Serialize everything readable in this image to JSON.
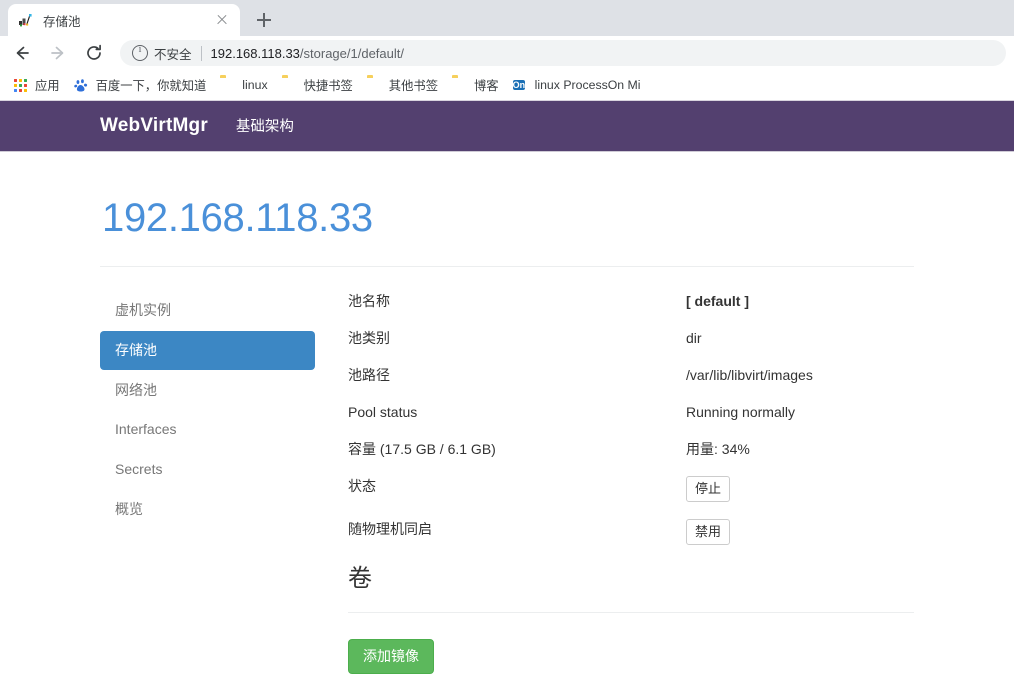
{
  "browser": {
    "tab": {
      "title": "存储池",
      "favicon": "webvirtmgr-favicon",
      "close_label": "×"
    },
    "newtab_label": "+",
    "toolbar": {
      "back": "back-arrow",
      "forward": "forward-arrow",
      "reload": "reload",
      "security_label": "不安全",
      "url_host": "192.168.118.33",
      "url_path": "/storage/1/default/"
    },
    "bookmarks": [
      {
        "label": "应用",
        "icon": "apps-grid-icon"
      },
      {
        "label": "百度一下，你就知道",
        "icon": "baidu-icon"
      },
      {
        "label": "linux",
        "icon": "folder-icon"
      },
      {
        "label": "快捷书签",
        "icon": "folder-icon"
      },
      {
        "label": "其他书签",
        "icon": "folder-icon"
      },
      {
        "label": "博客",
        "icon": "folder-icon"
      },
      {
        "label": "linux  ProcessOn  Mi",
        "icon": "on-icon"
      }
    ]
  },
  "navbar": {
    "brand": "WebVirtMgr",
    "links": [
      {
        "label": "基础架构"
      }
    ]
  },
  "page": {
    "title": "192.168.118.33",
    "sidebar": [
      {
        "label": "虚机实例",
        "active": false
      },
      {
        "label": "存储池",
        "active": true
      },
      {
        "label": "网络池",
        "active": false
      },
      {
        "label": "Interfaces",
        "active": false
      },
      {
        "label": "Secrets",
        "active": false
      },
      {
        "label": "概览",
        "active": false
      }
    ],
    "details": [
      {
        "term": "池名称",
        "value": "[ default ]",
        "bold": true,
        "type": "text"
      },
      {
        "term": "池类别",
        "value": "dir",
        "bold": false,
        "type": "text"
      },
      {
        "term": "池路径",
        "value": "/var/lib/libvirt/images",
        "bold": false,
        "type": "text"
      },
      {
        "term": "Pool status",
        "value": "Running normally",
        "bold": false,
        "type": "text"
      },
      {
        "term": "容量 (17.5 GB / 6.1 GB)",
        "value": "用量: 34%",
        "bold": false,
        "type": "text"
      },
      {
        "term": "状态",
        "value": "停止",
        "bold": false,
        "type": "button"
      },
      {
        "term": "随物理机同启",
        "value": "禁用",
        "bold": false,
        "type": "button"
      }
    ],
    "volumes_heading": "卷",
    "add_image_button": "添加镜像"
  },
  "colors": {
    "navbar_purple": "#53406f",
    "title_blue": "#4a90d9",
    "active_pill_blue": "#3c87c4",
    "success_green": "#5cb85c",
    "chrome_gray": "#dee1e6"
  }
}
